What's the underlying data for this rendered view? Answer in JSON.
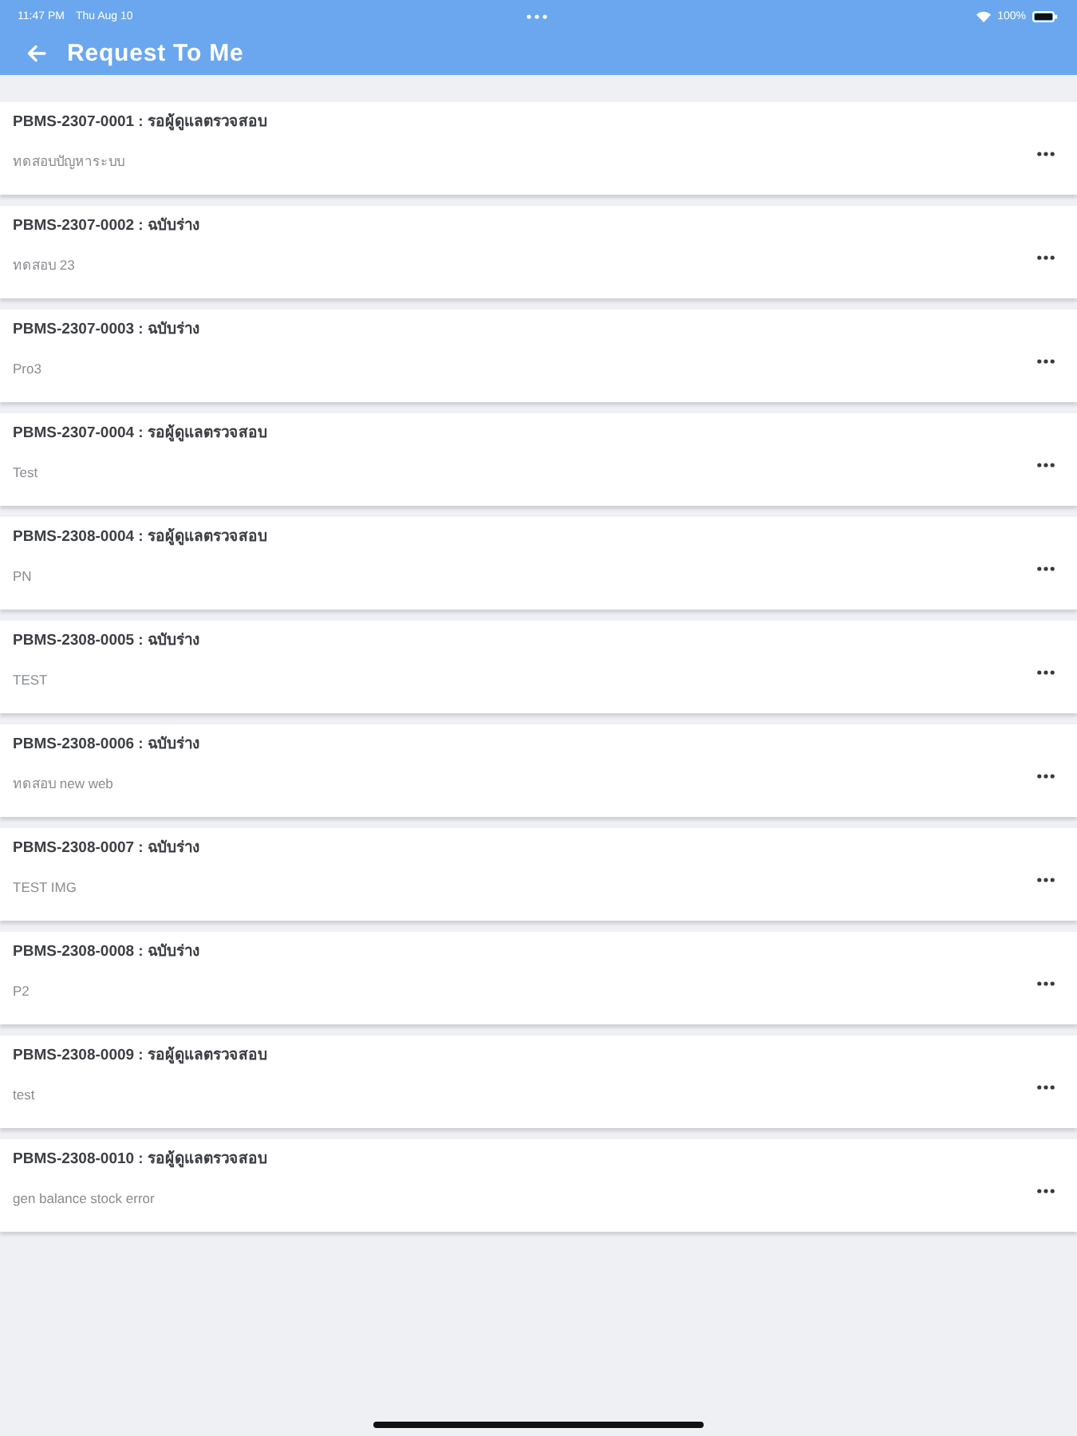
{
  "status_bar": {
    "time": "11:47 PM",
    "date": "Thu Aug 10",
    "battery": "100%"
  },
  "header": {
    "title": "Request To Me"
  },
  "requests": [
    {
      "title": "PBMS-2307-0001 : รอผู้ดูแลตรวจสอบ",
      "description": "ทดสอบปัญหาระบบ"
    },
    {
      "title": "PBMS-2307-0002 : ฉบับร่าง",
      "description": "ทดสอบ 23"
    },
    {
      "title": "PBMS-2307-0003 : ฉบับร่าง",
      "description": "Pro3"
    },
    {
      "title": "PBMS-2307-0004 : รอผู้ดูแลตรวจสอบ",
      "description": "Test"
    },
    {
      "title": "PBMS-2308-0004 : รอผู้ดูแลตรวจสอบ",
      "description": "PN"
    },
    {
      "title": "PBMS-2308-0005 : ฉบับร่าง",
      "description": "TEST"
    },
    {
      "title": "PBMS-2308-0006 : ฉบับร่าง",
      "description": "ทดสอบ new web"
    },
    {
      "title": "PBMS-2308-0007 : ฉบับร่าง",
      "description": "TEST IMG"
    },
    {
      "title": "PBMS-2308-0008 : ฉบับร่าง",
      "description": "P2"
    },
    {
      "title": "PBMS-2308-0009 : รอผู้ดูแลตรวจสอบ",
      "description": "test"
    },
    {
      "title": "PBMS-2308-0010 : รอผู้ดูแลตรวจสอบ",
      "description": "gen balance stock error"
    }
  ]
}
